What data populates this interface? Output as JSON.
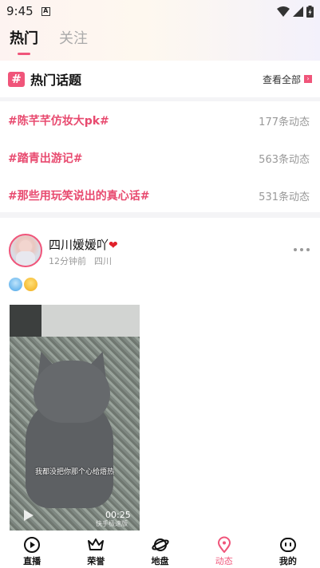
{
  "status_bar": {
    "time": "9:45",
    "notification_icon": "A"
  },
  "tabs": [
    {
      "label": "热门",
      "active": true
    },
    {
      "label": "关注",
      "active": false
    }
  ],
  "topics": {
    "title": "热门话题",
    "see_all": "查看全部",
    "items": [
      {
        "name": "#陈芊芊仿妆大pk#",
        "count": "177条动态"
      },
      {
        "name": "#踏青出游记#",
        "count": "563条动态"
      },
      {
        "name": "#那些用玩笑说出的真心话#",
        "count": "531条动态"
      }
    ]
  },
  "post": {
    "user_name": "四川媛媛吖",
    "time_ago": "12分钟前",
    "location": "四川",
    "video": {
      "subtitle": "我都没把你那个心给焐热",
      "duration": "00:25",
      "watermark": "快手极速版"
    }
  },
  "bottom_nav": [
    {
      "label": "直播",
      "icon": "live-icon",
      "active": false
    },
    {
      "label": "荣誉",
      "icon": "crown-icon",
      "active": false
    },
    {
      "label": "地盘",
      "icon": "planet-icon",
      "active": false
    },
    {
      "label": "动态",
      "icon": "location-pin-icon",
      "active": true
    },
    {
      "label": "我的",
      "icon": "profile-face-icon",
      "active": false
    }
  ],
  "colors": {
    "accent": "#f0557a",
    "topic_text": "#e84a6f"
  }
}
